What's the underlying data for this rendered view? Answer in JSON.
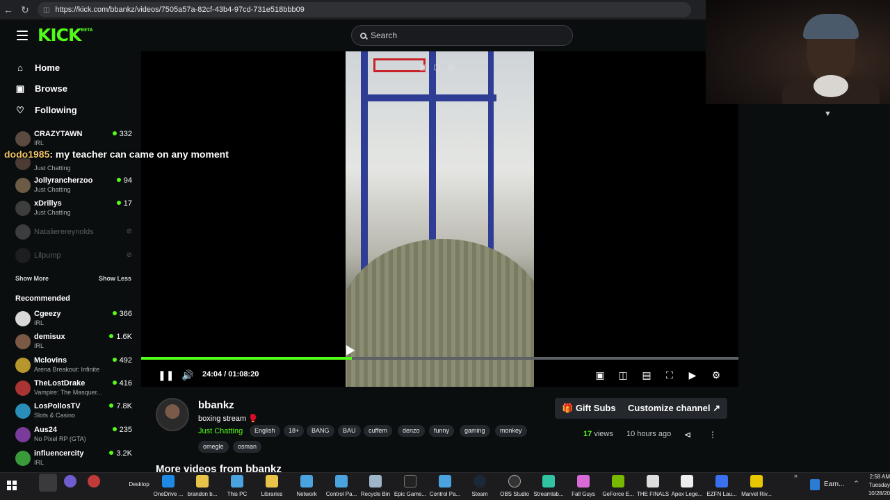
{
  "browser": {
    "url": "https://kick.com/bbankz/videos/7505a57a-82cf-43b4-97cd-731e518bbb09"
  },
  "header": {
    "logo": "KICK",
    "logo_badge": "BETA",
    "search_placeholder": "Search"
  },
  "nav": [
    {
      "label": "Home",
      "icon": "home-icon"
    },
    {
      "label": "Browse",
      "icon": "browse-icon"
    },
    {
      "label": "Following",
      "icon": "heart-icon"
    }
  ],
  "following": [
    {
      "name": "CRAZYTAWN",
      "category": "IRL",
      "viewers": "332"
    },
    {
      "name": "",
      "category": "Just Chatting",
      "viewers": ""
    },
    {
      "name": "Jollyrancherzoo",
      "category": "Just Chatting",
      "viewers": "94"
    },
    {
      "name": "xDrillys",
      "category": "Just Chatting",
      "viewers": "17"
    }
  ],
  "offline": [
    {
      "name": "Natalierereynolds"
    },
    {
      "name": "Lilpump"
    }
  ],
  "sidebar_buttons": {
    "show_more": "Show More",
    "show_less": "Show Less"
  },
  "recommended_heading": "Recommended",
  "recommended": [
    {
      "name": "Cgeezy",
      "category": "IRL",
      "viewers": "366"
    },
    {
      "name": "demisux",
      "category": "IRL",
      "viewers": "1.6K"
    },
    {
      "name": "Mclovins",
      "category": "Arena Breakout: Infinite",
      "viewers": "492"
    },
    {
      "name": "TheLostDrake",
      "category": "Vampire: The Masquer...",
      "viewers": "416"
    },
    {
      "name": "LosPollosTV",
      "category": "Slots & Casino",
      "viewers": "7.8K"
    },
    {
      "name": "Aus24",
      "category": "No Pixel RP (GTA)",
      "viewers": "235"
    },
    {
      "name": "influencercity",
      "category": "IRL",
      "viewers": "3.2K"
    }
  ],
  "chat_overlay": {
    "user": "dodo1985",
    "message": ": my teacher can came on any moment"
  },
  "player": {
    "time": "24:04 / 01:08:20",
    "progress": 0.3524
  },
  "video": {
    "channel": "bbankz",
    "title": "boxing stream 🥊",
    "category": "Just Chatting",
    "tags": [
      "English",
      "18+",
      "BANG",
      "BAU",
      "cuffem",
      "denzo",
      "funny",
      "gaming",
      "monkey",
      "omegle",
      "osman"
    ],
    "gift_subs": "Gift Subs",
    "customize": "Customize channel",
    "views_count": "17",
    "views_label": "views",
    "ago": "10 hours ago",
    "more_videos": "More videos from bbankz"
  },
  "taskbar": {
    "items": [
      {
        "label": "Desktop",
        "color": ""
      },
      {
        "label": "OneDrive ...",
        "color": "#1e88e5"
      },
      {
        "label": "brandon b...",
        "color": "#e8c34a"
      },
      {
        "label": "This PC",
        "color": "#4aa3df"
      },
      {
        "label": "Libraries",
        "color": "#e8c34a"
      },
      {
        "label": "Network",
        "color": "#4aa3df"
      },
      {
        "label": "Control Pa...",
        "color": "#4aa3df"
      },
      {
        "label": "Recycle Bin",
        "color": "#9fb6c8"
      },
      {
        "label": "Epic Game...",
        "color": "#222222"
      },
      {
        "label": "Control Pa...",
        "color": "#4aa3df"
      },
      {
        "label": "Steam",
        "color": "#1b2838"
      },
      {
        "label": "OBS Studio",
        "color": "#333333"
      },
      {
        "label": "Streamlab...",
        "color": "#31c3a2"
      },
      {
        "label": "Fall Guys",
        "color": "#d86ad8"
      },
      {
        "label": "GeForce E...",
        "color": "#76b900"
      },
      {
        "label": "THE FINALS",
        "color": "#dddddd"
      },
      {
        "label": "Apex Lege...",
        "color": "#eeeeee"
      },
      {
        "label": "EZFN Lau...",
        "color": "#3a6ff0"
      },
      {
        "label": "Marvel Riv...",
        "color": "#e8c600"
      }
    ],
    "tray_app": "Earn...",
    "clock_time": "2:58 AM",
    "clock_day": "Tuesday",
    "clock_date": "10/28/20"
  },
  "colors": {
    "brand": "#53fc18",
    "bg": "#0b0e0f",
    "chip": "#24272c"
  }
}
